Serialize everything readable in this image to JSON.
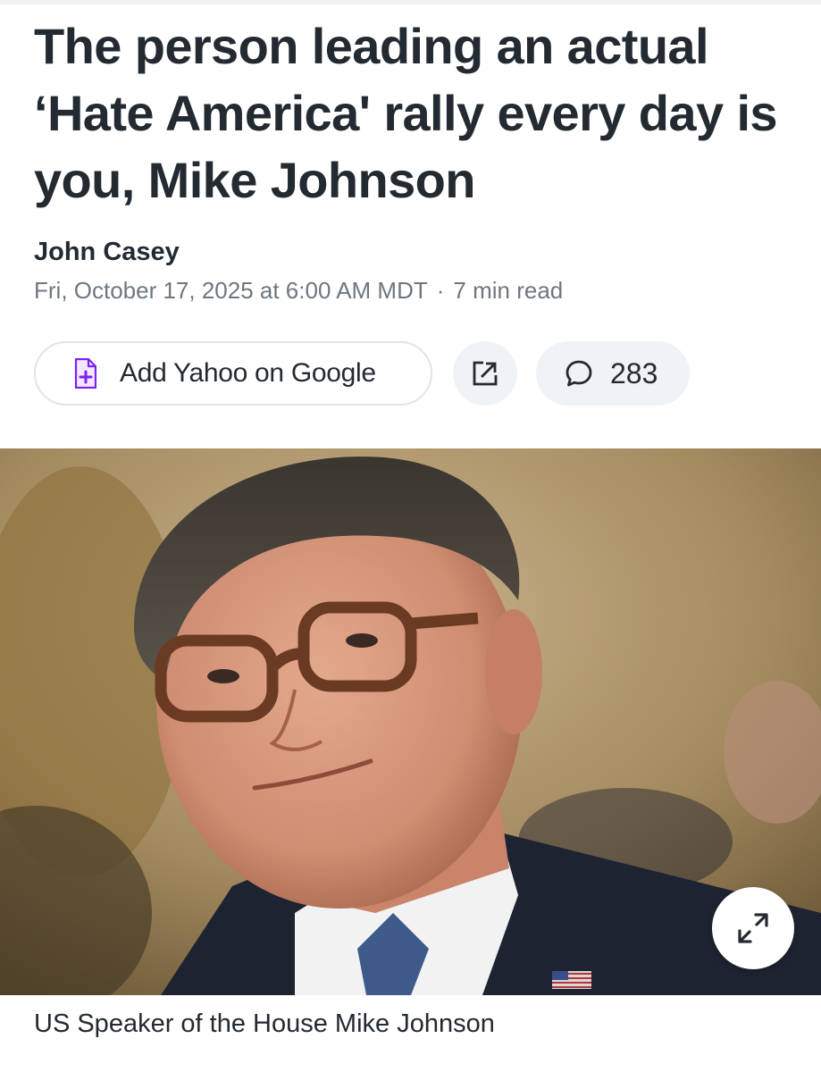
{
  "article": {
    "headline": "The person leading an actual ‘Hate America' rally every day is you, Mike Johnson",
    "author": "John Casey",
    "date": "Fri, October 17, 2025 at 6:00 AM MDT",
    "separator": "·",
    "read_time": "7 min read"
  },
  "actions": {
    "add_label": "Add Yahoo on Google",
    "add_icon": "add-document-icon",
    "share_icon": "share-icon",
    "comment_icon": "comment-icon",
    "comment_count": "283"
  },
  "image": {
    "caption": "US Speaker of the House Mike Johnson",
    "expand_icon": "expand-icon"
  },
  "colors": {
    "accent": "#7e1fff",
    "text": "#232a31",
    "meta": "#6e7780",
    "chip_bg": "#f0f3f5"
  }
}
